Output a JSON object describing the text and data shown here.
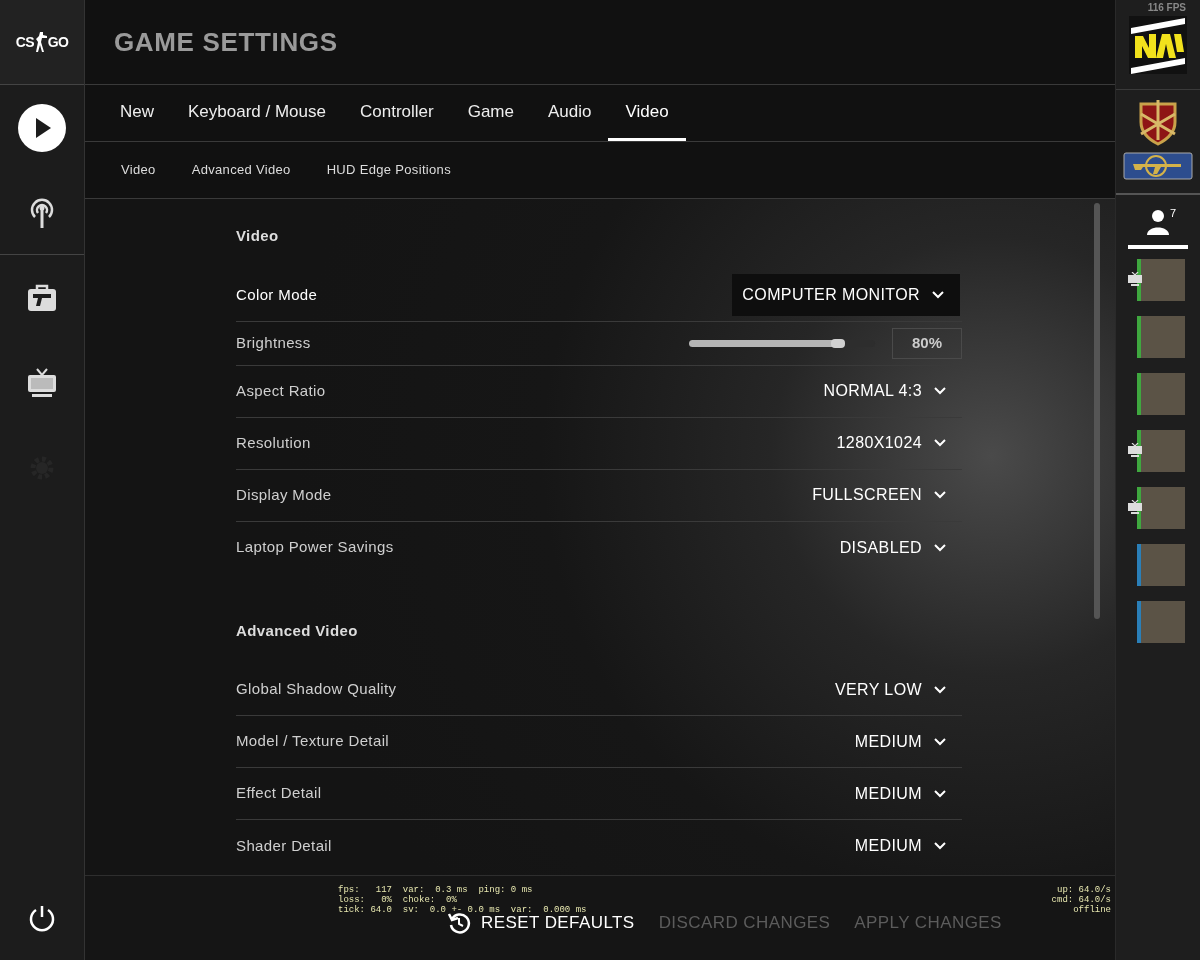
{
  "logo": {
    "left": "CS",
    "right": "GO"
  },
  "nav": [
    {
      "kind": "play",
      "selected": true,
      "disabled": false
    },
    {
      "kind": "antenna",
      "selected": false,
      "disabled": false
    },
    {
      "kind": "inventory",
      "selected": false,
      "disabled": false
    },
    {
      "kind": "tv",
      "selected": false,
      "disabled": false
    },
    {
      "kind": "settings",
      "selected": false,
      "disabled": true
    }
  ],
  "title": "GAME SETTINGS",
  "tabs": [
    {
      "label": "New",
      "selected": false
    },
    {
      "label": "Keyboard / Mouse",
      "selected": false
    },
    {
      "label": "Controller",
      "selected": false
    },
    {
      "label": "Game",
      "selected": false
    },
    {
      "label": "Audio",
      "selected": false
    },
    {
      "label": "Video",
      "selected": true
    }
  ],
  "subtabs": [
    {
      "label": "Video"
    },
    {
      "label": "Advanced Video"
    },
    {
      "label": "HUD Edge Positions"
    }
  ],
  "sections": [
    {
      "title": "Video",
      "rows": [
        {
          "kind": "dropdown",
          "label": "Color Mode",
          "value": "COMPUTER MONITOR",
          "highlighted": true
        },
        {
          "kind": "slider",
          "label": "Brightness",
          "level": 0.8,
          "reading": "80%",
          "highlighted": false
        },
        {
          "kind": "dropdown",
          "label": "Aspect Ratio",
          "value": "NORMAL 4:3",
          "highlighted": false
        },
        {
          "kind": "dropdown",
          "label": "Resolution",
          "value": "1280X1024",
          "highlighted": false
        },
        {
          "kind": "dropdown",
          "label": "Display Mode",
          "value": "FULLSCREEN",
          "highlighted": false
        },
        {
          "kind": "dropdown",
          "label": "Laptop Power Savings",
          "value": "DISABLED",
          "highlighted": false
        }
      ]
    },
    {
      "title": "Advanced Video",
      "rows": [
        {
          "kind": "dropdown",
          "label": "Global Shadow Quality",
          "value": "VERY LOW",
          "highlighted": false
        },
        {
          "kind": "dropdown",
          "label": "Model / Texture Detail",
          "value": "MEDIUM",
          "highlighted": false
        },
        {
          "kind": "dropdown",
          "label": "Effect Detail",
          "value": "MEDIUM",
          "highlighted": false
        },
        {
          "kind": "dropdown",
          "label": "Shader Detail",
          "value": "MEDIUM",
          "highlighted": false
        }
      ]
    }
  ],
  "netgraph": {
    "left": [
      "fps:   117  var:  0.3 ms  ping: 0 ms",
      "loss:   0%  choke:  0%",
      "tick: 64.0  sv:  0.0 +- 0.0 ms  var:  0.000 ms"
    ],
    "right": [
      "up: 64.0/s",
      "cmd: 64.0/s",
      "offline"
    ]
  },
  "buttons": [
    {
      "kind": "reset",
      "label": "RESET DEFAULTS",
      "disabled": false
    },
    {
      "kind": "plain",
      "label": "DISCARD CHANGES",
      "disabled": true
    },
    {
      "kind": "plain",
      "label": "APPLY CHANGES",
      "disabled": true
    }
  ],
  "fps": "116 FPS",
  "friends_count": "7",
  "friends": [
    {
      "color": "#3fa83f",
      "watching": true
    },
    {
      "color": "#3fa83f",
      "watching": false
    },
    {
      "color": "#3fa83f",
      "watching": false
    },
    {
      "color": "#3fa83f",
      "watching": true
    },
    {
      "color": "#3fa83f",
      "watching": true
    },
    {
      "color": "#2a7fb8",
      "watching": false
    },
    {
      "color": "#2a7fb8",
      "watching": false
    }
  ]
}
